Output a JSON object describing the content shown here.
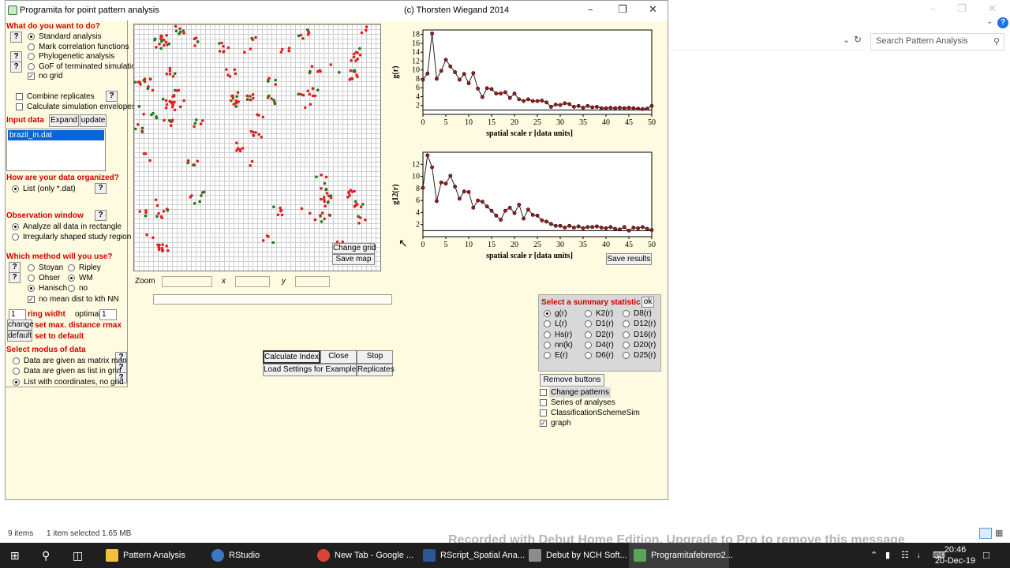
{
  "explorer": {
    "search_placeholder": "Search Pattern Analysis",
    "status_items": "9 items",
    "status_selected": "1 item selected  1.65 MB"
  },
  "app": {
    "title": "Programita for point pattern analysis",
    "author": "(c) Thorsten Wiegand 2014",
    "left": {
      "what_header": "What do you want to do?",
      "opt_standard": "Standard analysis",
      "opt_mark": "Mark correlation functions",
      "opt_phylo": "Phylogenetic analysis",
      "opt_gof": "GoF of terminated simulation",
      "chk_nogrid": "no grid",
      "chk_combine": "Combine replicates",
      "chk_envelopes": "Calculate simulation envelopes",
      "input_header": "Input data",
      "expand": "Expand",
      "update": "update",
      "file": "brazil_in.dat",
      "organized_header": "How are your data organized?",
      "list_option": "List  (only *.dat)",
      "obs_header": "Observation window",
      "obs_rect": "Analyze all data in rectangle",
      "obs_irregular": "Irregularly shaped study region",
      "method_header": "Which method will you use?",
      "m_stoyan": "Stoyan",
      "m_ripley": "Ripley",
      "m_ohser": "Ohser",
      "m_wm": "WM",
      "m_hanisch": "Hanisch",
      "m_no": "no",
      "chk_nomean": "no mean dist to kth NN",
      "ring_value": "1",
      "ring_label": "ring widht",
      "optimal_label": "optimal:",
      "optimal_value": "1",
      "change": "change",
      "set_max": "set max. distance rmax",
      "default": "default",
      "set_default": "set to default",
      "modus_header": "Select modus of data",
      "modus_matrix": "Data are given as matrix map",
      "modus_list": "Data are given as list in grid",
      "modus_coords": "List with coordinates, no grid"
    },
    "map": {
      "change_grid": "Change grid",
      "save_map": "Save map",
      "zoom_label": "Zoom",
      "x_label": "x",
      "y_label": "y"
    },
    "buttons": {
      "calc": "Calculate Index",
      "close": "Close",
      "stop": "Stop",
      "load": "Load Settings for Example",
      "replicates": "Replicates",
      "save_results": "Save results",
      "remove": "Remove buttons"
    },
    "stats": {
      "header": "Select a summary statistic",
      "ok": "ok",
      "col1": [
        "g(r)",
        "L(r)",
        "Hs(r)",
        "nn(k)",
        "E(r)"
      ],
      "col2": [
        "K2(r)",
        "D1(r)",
        "D2(r)",
        "D4(r)",
        "D6(r)"
      ],
      "col3": [
        "D8(r)",
        "D12(r)",
        "D16(r)",
        "D20(r)",
        "D25(r)"
      ],
      "selected": "g(r)"
    },
    "options": {
      "change_patterns": "Change patterns",
      "series": "Series of analyses",
      "classification": "ClassificationSchemeSim",
      "graph": "graph"
    }
  },
  "taskbar": {
    "items": [
      "Pattern Analysis",
      "RStudio",
      "New Tab - Google ...",
      "RScript_Spatial Ana...",
      "Debut by NCH Soft...",
      "Programitafebrero2..."
    ],
    "time": "20:46",
    "date": "20-Dec-19"
  },
  "watermark": "Recorded with Debut Home Edition. Upgrade to Pro to remove this message",
  "chart_data": [
    {
      "type": "line",
      "ylabel": "g(r)",
      "xlabel": "spatial scale r [data units]",
      "xlim": [
        0,
        50
      ],
      "ylim": [
        0,
        19
      ],
      "xticks": [
        0,
        5,
        10,
        15,
        20,
        25,
        30,
        35,
        40,
        45,
        50
      ],
      "yticks": [
        2,
        4,
        6,
        8,
        10,
        12,
        14,
        16,
        18
      ],
      "reference_line": 1,
      "x": [
        0,
        1,
        2,
        3,
        4,
        5,
        6,
        7,
        8,
        9,
        10,
        11,
        12,
        13,
        14,
        15,
        16,
        17,
        18,
        19,
        20,
        21,
        22,
        23,
        24,
        25,
        26,
        27,
        28,
        29,
        30,
        31,
        32,
        33,
        34,
        35,
        36,
        37,
        38,
        39,
        40,
        41,
        42,
        43,
        44,
        45,
        46,
        47,
        48,
        49,
        50
      ],
      "values": [
        7.8,
        9.2,
        18.2,
        8,
        9.8,
        12.3,
        10.8,
        9.5,
        7.8,
        9.1,
        7.0,
        9.3,
        5.8,
        3.9,
        5.9,
        5.7,
        4.7,
        4.7,
        5.0,
        3.7,
        4.7,
        3.4,
        3.0,
        3.4,
        3.0,
        3.0,
        3.1,
        2.7,
        1.7,
        2.2,
        2.1,
        2.5,
        2.3,
        1.7,
        1.9,
        1.5,
        1.9,
        1.6,
        1.7,
        1.4,
        1.4,
        1.5,
        1.4,
        1.5,
        1.4,
        1.5,
        1.4,
        1.3,
        1.2,
        1.3,
        1.9
      ]
    },
    {
      "type": "line",
      "ylabel": "g12(r)",
      "xlabel": "spatial scale r [data units]",
      "xlim": [
        0,
        50
      ],
      "ylim": [
        0,
        14
      ],
      "xticks": [
        0,
        5,
        10,
        15,
        20,
        25,
        30,
        35,
        40,
        45,
        50
      ],
      "yticks": [
        2,
        4,
        6,
        8,
        10,
        12
      ],
      "reference_line": 1,
      "x": [
        0,
        1,
        2,
        3,
        4,
        5,
        6,
        7,
        8,
        9,
        10,
        11,
        12,
        13,
        14,
        15,
        16,
        17,
        18,
        19,
        20,
        21,
        22,
        23,
        24,
        25,
        26,
        27,
        28,
        29,
        30,
        31,
        32,
        33,
        34,
        35,
        36,
        37,
        38,
        39,
        40,
        41,
        42,
        43,
        44,
        45,
        46,
        47,
        48,
        49,
        50
      ],
      "values": [
        8.1,
        13.5,
        11.5,
        5.9,
        9.0,
        8.8,
        10.1,
        8.3,
        6.3,
        7.5,
        7.4,
        4.8,
        6.0,
        5.8,
        5.0,
        4.3,
        3.5,
        2.8,
        4.3,
        4.8,
        3.9,
        5.3,
        3.0,
        4.5,
        3.6,
        3.5,
        2.7,
        2.5,
        2.1,
        1.8,
        1.8,
        1.5,
        1.8,
        1.5,
        1.7,
        1.4,
        1.6,
        1.6,
        1.7,
        1.5,
        1.4,
        1.6,
        1.3,
        1.2,
        1.6,
        1.0,
        1.5,
        1.4,
        1.6,
        1.3,
        1.1
      ]
    }
  ]
}
